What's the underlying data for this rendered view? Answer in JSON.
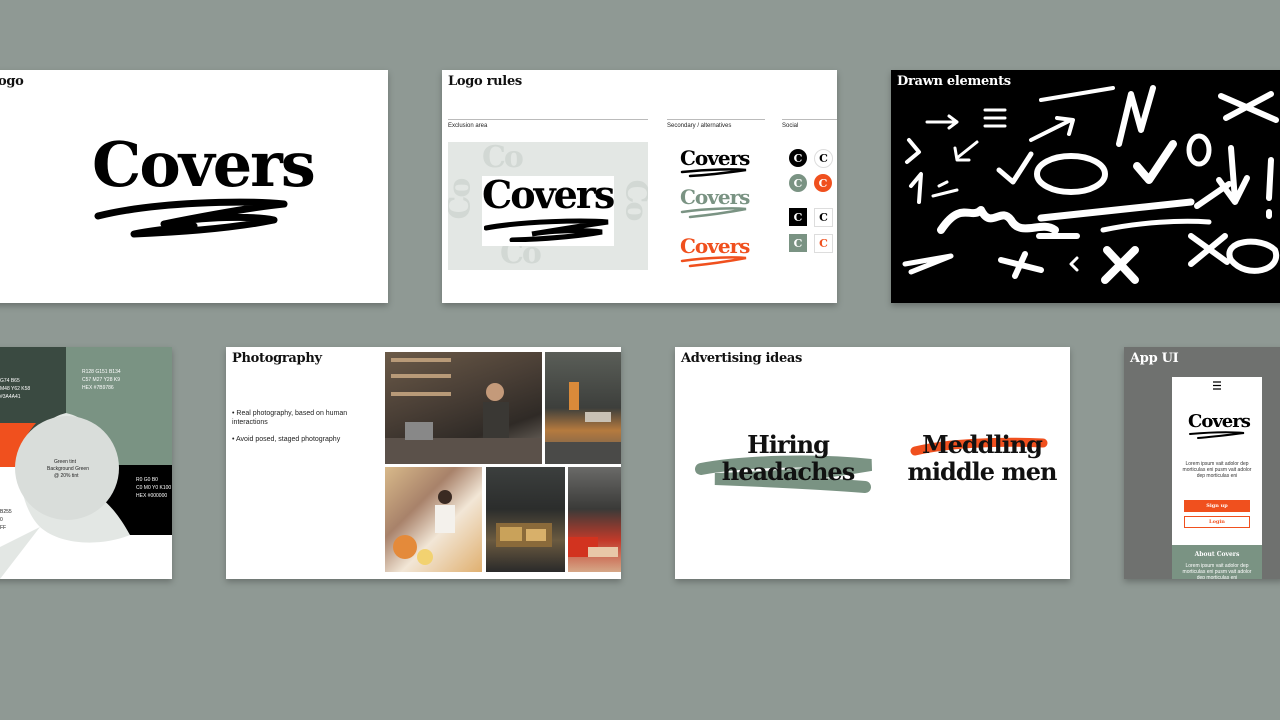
{
  "colors": {
    "background": "#8f9994",
    "sage_green": "#7a9383",
    "orange": "#f0501e",
    "black": "#000000",
    "white": "#ffffff",
    "tint": "#e3e7e4"
  },
  "logo_slide": {
    "title": "ogo",
    "brand": "Covers"
  },
  "logo_rules": {
    "title": "Logo rules",
    "exclusion_label": "Exclusion area",
    "secondary_label": "Secondary / alternatives",
    "social_label": "Social",
    "brand": "Covers",
    "ghost_letters": "Co",
    "social_letter": "C"
  },
  "drawn_elements": {
    "title": "Drawn elements"
  },
  "color_slide": {
    "green_codes": [
      "R128 G151 B134",
      "C57 M27 Y28 K9",
      "HEX #7B9786"
    ],
    "dark_codes": [
      "G74 B65",
      "M48 Y62 K58",
      "#3A4A41"
    ],
    "black_codes": [
      "R0 G0 B0",
      "C0 M0 Y0 K100",
      "HEX #000000"
    ],
    "orange_codes": [
      "B255",
      "0",
      "FF"
    ],
    "center_lines": [
      "Green tint",
      "Background Green",
      "@ 20% tint"
    ]
  },
  "photography": {
    "title": "Photography",
    "bullets": [
      "Real photography, based on human interactions",
      "Avoid posed, staged photography"
    ]
  },
  "advertising": {
    "title": "Advertising ideas",
    "ad1_line1": "Hiring",
    "ad1_line2": "headaches",
    "ad2_line1": "Meddling",
    "ad2_line2": "middle men"
  },
  "app_ui": {
    "title": "App UI",
    "menu_icon": "hamburger-icon",
    "brand": "Covers",
    "body_text": "Lorem ipsum vait adolor dep morticulas eni pusm vait adolor dep morticulas eni",
    "signup_label": "Sign up",
    "login_label": "Login",
    "about_label": "About Covers",
    "about_text": "Lorem ipsum vait adolor dep morticulas eni pusm vait adolor dep morticulas eni"
  }
}
